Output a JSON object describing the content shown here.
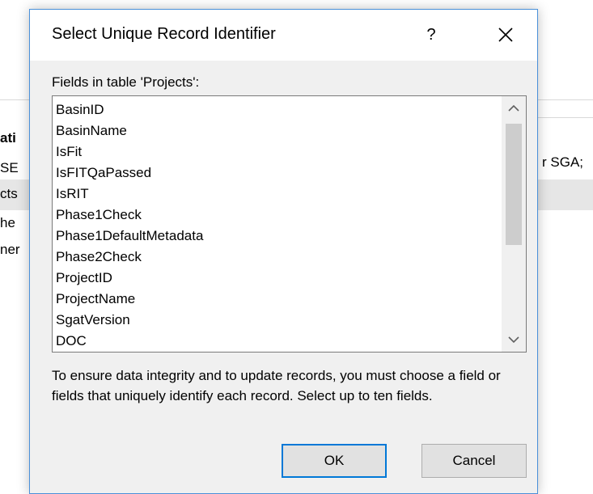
{
  "background": {
    "fragments_left": [
      "ati",
      "SE",
      "cts",
      "he",
      "ner"
    ],
    "fragment_right": "r SGA;"
  },
  "dialog": {
    "title": "Select Unique Record Identifier",
    "help_label": "?",
    "close_icon": "close-icon",
    "fields_label": "Fields in table 'Projects':",
    "fields": [
      "BasinID",
      "BasinName",
      "IsFit",
      "IsFITQaPassed",
      "IsRIT",
      "Phase1Check",
      "Phase1DefaultMetadata",
      "Phase2Check",
      "ProjectID",
      "ProjectName",
      "SgatVersion",
      "DOC"
    ],
    "help_text": "To ensure data integrity and to update records, you must choose a field or fields that uniquely identify each record. Select up to ten fields.",
    "ok_label": "OK",
    "cancel_label": "Cancel"
  }
}
